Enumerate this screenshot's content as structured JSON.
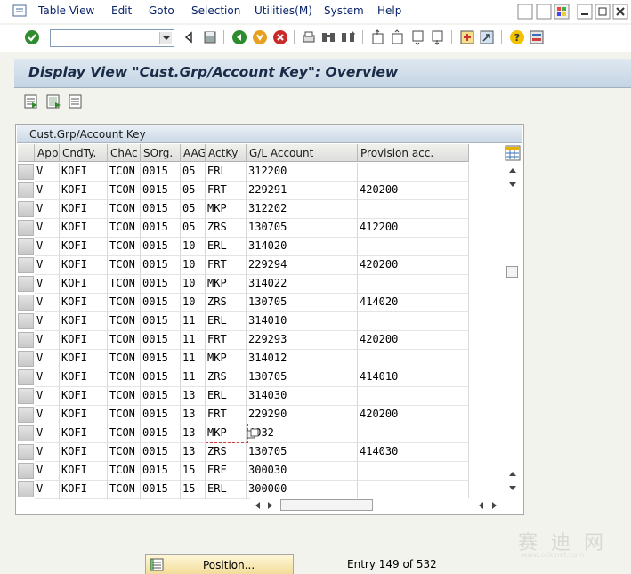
{
  "menu": [
    "Table View",
    "Edit",
    "Goto",
    "Selection",
    "Utilities(M)",
    "System",
    "Help"
  ],
  "toolbar": {
    "command_value": "",
    "icons": [
      "enter-icon",
      "back-icon",
      "save-icon",
      "green-back-icon",
      "exit-icon",
      "cancel-icon",
      "print-icon",
      "find-icon",
      "find-next-icon",
      "first-page-icon",
      "previous-page-icon",
      "next-page-icon",
      "last-page-icon",
      "create-session-icon",
      "shortcut-icon",
      "help-icon",
      "customize-layout-icon"
    ]
  },
  "title": "Display View \"Cust.Grp/Account Key\": Overview",
  "app_toolbar": [
    "details-icon",
    "select-all-icon",
    "deselect-all-icon"
  ],
  "table": {
    "caption": "Cust.Grp/Account Key",
    "columns": [
      "App",
      "CndTy.",
      "ChAc",
      "SOrg.",
      "AAG",
      "ActKy",
      "G/L Account",
      "Provision acc."
    ],
    "rows": [
      [
        "V",
        "KOFI",
        "TCON",
        "0015",
        "05",
        "ERL",
        "312200",
        ""
      ],
      [
        "V",
        "KOFI",
        "TCON",
        "0015",
        "05",
        "FRT",
        "229291",
        "420200"
      ],
      [
        "V",
        "KOFI",
        "TCON",
        "0015",
        "05",
        "MKP",
        "312202",
        ""
      ],
      [
        "V",
        "KOFI",
        "TCON",
        "0015",
        "05",
        "ZRS",
        "130705",
        "412200"
      ],
      [
        "V",
        "KOFI",
        "TCON",
        "0015",
        "10",
        "ERL",
        "314020",
        ""
      ],
      [
        "V",
        "KOFI",
        "TCON",
        "0015",
        "10",
        "FRT",
        "229294",
        "420200"
      ],
      [
        "V",
        "KOFI",
        "TCON",
        "0015",
        "10",
        "MKP",
        "314022",
        ""
      ],
      [
        "V",
        "KOFI",
        "TCON",
        "0015",
        "10",
        "ZRS",
        "130705",
        "414020"
      ],
      [
        "V",
        "KOFI",
        "TCON",
        "0015",
        "11",
        "ERL",
        "314010",
        ""
      ],
      [
        "V",
        "KOFI",
        "TCON",
        "0015",
        "11",
        "FRT",
        "229293",
        "420200"
      ],
      [
        "V",
        "KOFI",
        "TCON",
        "0015",
        "11",
        "MKP",
        "314012",
        ""
      ],
      [
        "V",
        "KOFI",
        "TCON",
        "0015",
        "11",
        "ZRS",
        "130705",
        "414010"
      ],
      [
        "V",
        "KOFI",
        "TCON",
        "0015",
        "13",
        "ERL",
        "314030",
        ""
      ],
      [
        "V",
        "KOFI",
        "TCON",
        "0015",
        "13",
        "FRT",
        "229290",
        "420200"
      ],
      [
        "V",
        "KOFI",
        "TCON",
        "0015",
        "13",
        "MKP",
        "4032",
        ""
      ],
      [
        "V",
        "KOFI",
        "TCON",
        "0015",
        "13",
        "ZRS",
        "130705",
        "414030"
      ],
      [
        "V",
        "KOFI",
        "TCON",
        "0015",
        "15",
        "ERF",
        "300030",
        ""
      ],
      [
        "V",
        "KOFI",
        "TCON",
        "0015",
        "15",
        "ERL",
        "300000",
        ""
      ]
    ]
  },
  "position_button": "Position...",
  "entry_info": "Entry 149 of 532",
  "watermark": {
    "text": "赛 迪 网",
    "sub": "www.ccidnet.com"
  }
}
